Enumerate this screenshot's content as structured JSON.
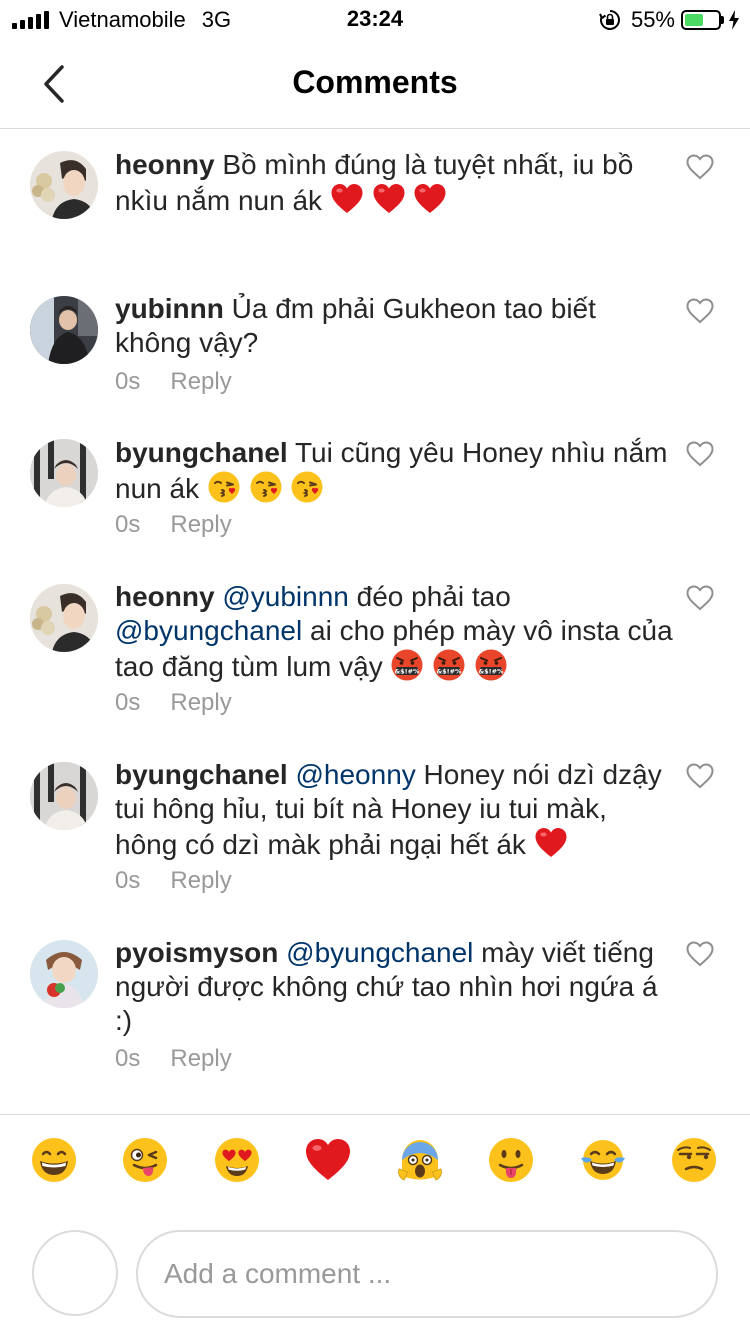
{
  "status_bar": {
    "carrier": "Vietnamobile",
    "network": "3G",
    "time": "23:24",
    "battery_percent": "55%",
    "battery_level": 0.55
  },
  "header": {
    "title": "Comments"
  },
  "comments": [
    {
      "username": "heonny",
      "segments": [
        "Bồ mình đúng là tuyệt nhất, iu bồ nkìu nắm nun ák "
      ],
      "emojis": [
        "red-heart",
        "red-heart",
        "red-heart"
      ]
    },
    {
      "username": "yubinnn",
      "segments": [
        "Ủa đm phải Gukheon tao biết không vậy?"
      ],
      "time": "0s",
      "reply": "Reply"
    },
    {
      "username": "byungchanel",
      "segments": [
        "Tui cũng yêu Honey nhìu nắm nun ák "
      ],
      "emojis": [
        "kissing-face",
        "kissing-face",
        "kissing-face"
      ],
      "time": "0s",
      "reply": "Reply"
    },
    {
      "username": "heonny",
      "mention1": "@yubinnn",
      "text1": " đéo phải tao ",
      "mention2": "@byungchanel",
      "text2": " ai cho phép mày vô insta của tao đăng tùm lum vậy ",
      "emojis": [
        "cursing-face",
        "cursing-face",
        "cursing-face"
      ],
      "time": "0s",
      "reply": "Reply"
    },
    {
      "username": "byungchanel",
      "mention1": "@heonny",
      "text1": " Honey nói dzì dzậy tui hông hỉu, tui bít nà Honey iu tui màk, hông có dzì màk phải ngại hết ák ",
      "emojis": [
        "red-heart"
      ],
      "time": "0s",
      "reply": "Reply"
    },
    {
      "username": "pyoismyson",
      "mention1": "@byungchanel",
      "text1": " mày viết tiếng người được không chứ tao nhìn hơi ngứa á :)",
      "time": "0s",
      "reply": "Reply"
    }
  ],
  "emoji_bar": [
    "grinning-face",
    "winking-tongue-face",
    "heart-eyes-face",
    "red-heart",
    "screaming-face",
    "tongue-face",
    "tears-of-joy-face",
    "unamused-face"
  ],
  "composer": {
    "placeholder": "Add a comment ..."
  }
}
